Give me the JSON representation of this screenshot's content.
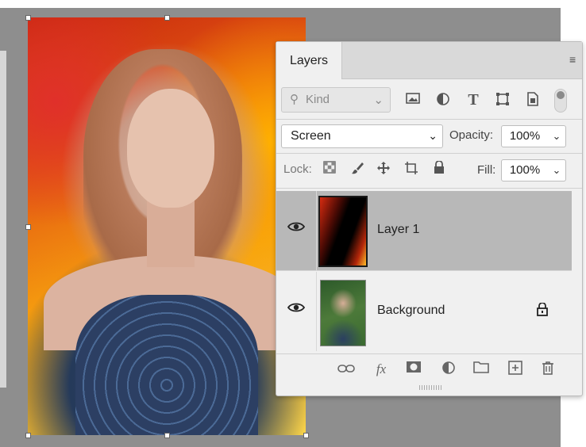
{
  "panel": {
    "tab_label": "Layers",
    "menu_icon": "panel-menu-icon"
  },
  "filter": {
    "kind_label": "Kind",
    "icons": [
      "image-filter-icon",
      "adjustment-filter-icon",
      "type-filter-icon",
      "shape-filter-icon",
      "smart-object-filter-icon"
    ]
  },
  "blend": {
    "mode": "Screen",
    "opacity_label": "Opacity:",
    "opacity_value": "100%",
    "lock_label": "Lock:",
    "fill_label": "Fill:",
    "fill_value": "100%"
  },
  "layers": [
    {
      "name": "Layer 1",
      "selected": true,
      "visible": true,
      "locked": false
    },
    {
      "name": "Background",
      "selected": false,
      "visible": true,
      "locked": true
    }
  ],
  "bottom_icons": [
    "link-layers-icon",
    "fx-icon",
    "layer-mask-icon",
    "adjustment-layer-icon",
    "group-folder-icon",
    "new-layer-icon",
    "trash-icon"
  ],
  "glyphs": {
    "fx": "fx",
    "eye": "👁",
    "lock": "🔒"
  }
}
